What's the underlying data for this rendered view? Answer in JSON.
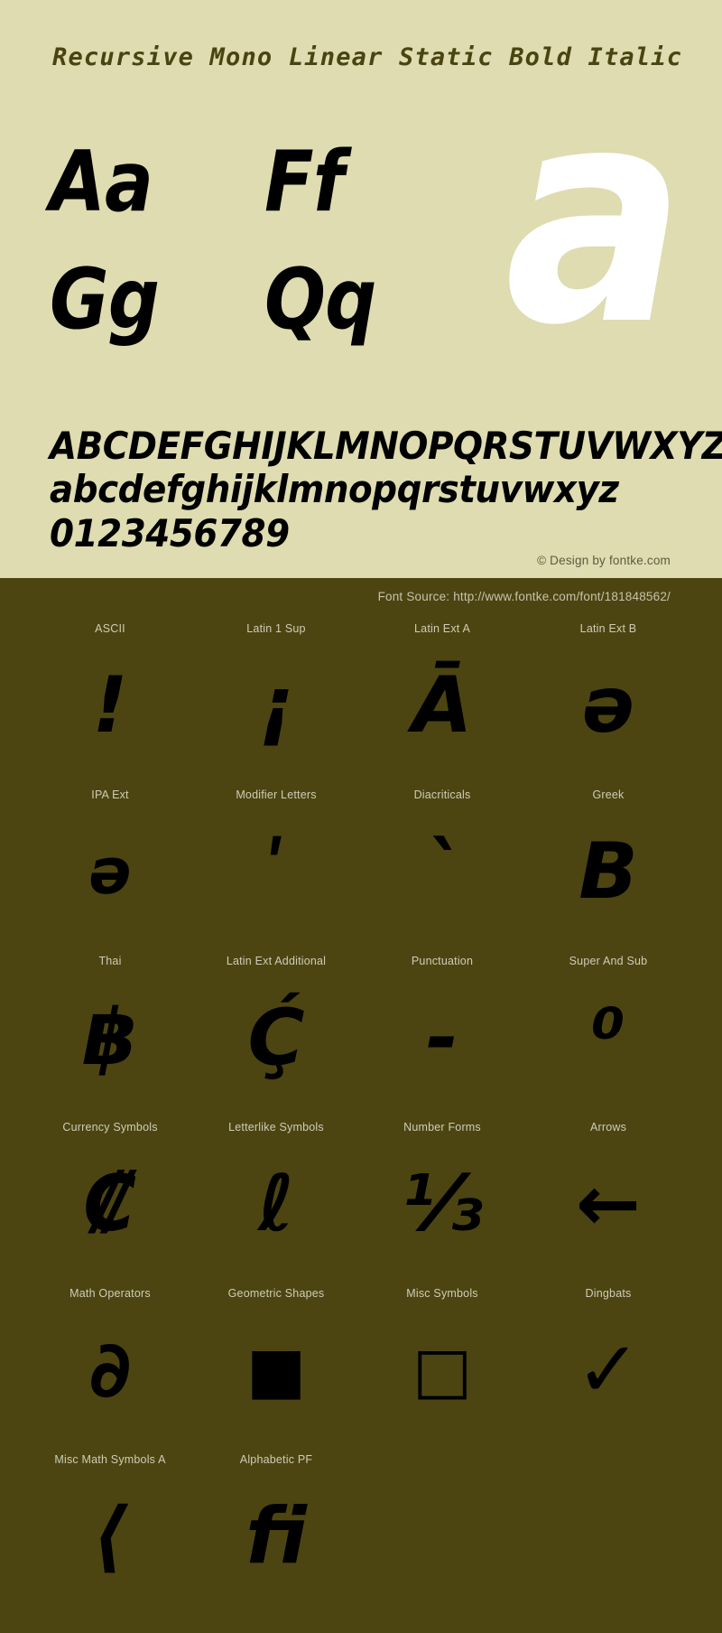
{
  "header": {
    "title": "Recursive Mono Linear Static Bold Italic",
    "background_color": "#dedcb0",
    "text_color": "#4a4312"
  },
  "specimen": {
    "letter_pairs": [
      "Aa",
      "Ff",
      "Gg",
      "Qq"
    ],
    "feature_glyph": "a",
    "feature_glyph_color": "#ffffff",
    "uppercase": "ABCDEFGHIJKLMNOPQRSTUVWXYZ",
    "lowercase": "abcdefghijklmnopqrstuvwxyz",
    "digits": "0123456789"
  },
  "credits": {
    "copyright": "© Design by fontke.com",
    "font_source": "Font Source: http://www.fontke.com/font/181848562/"
  },
  "glyph_grid": {
    "background_color": "#4c4512",
    "label_color": "#cfccb6",
    "glyph_color": "#000000",
    "rows": [
      [
        {
          "label": "ASCII",
          "glyph": "!",
          "size": "normal"
        },
        {
          "label": "Latin 1 Sup",
          "glyph": "¡",
          "size": "normal"
        },
        {
          "label": "Latin Ext A",
          "glyph": "Ā",
          "size": "normal"
        },
        {
          "label": "Latin Ext B",
          "glyph": "ə",
          "size": "normal"
        }
      ],
      [
        {
          "label": "IPA Ext",
          "glyph": "ə",
          "size": "small"
        },
        {
          "label": "Modifier Letters",
          "glyph": "ʹ",
          "size": "normal"
        },
        {
          "label": "Diacriticals",
          "glyph": "`",
          "size": "normal"
        },
        {
          "label": "Greek",
          "glyph": "Β",
          "size": "normal"
        }
      ],
      [
        {
          "label": "Thai",
          "glyph": "฿",
          "size": "normal"
        },
        {
          "label": "Latin Ext Additional",
          "glyph": "Ḉ",
          "size": "normal"
        },
        {
          "label": "Punctuation",
          "glyph": "‐",
          "size": "normal"
        },
        {
          "label": "Super And Sub",
          "glyph": "⁰",
          "size": "normal"
        }
      ],
      [
        {
          "label": "Currency Symbols",
          "glyph": "₡",
          "size": "normal"
        },
        {
          "label": "Letterlike Symbols",
          "glyph": "ℓ",
          "size": "normal"
        },
        {
          "label": "Number Forms",
          "glyph": "⅓",
          "size": "normal"
        },
        {
          "label": "Arrows",
          "glyph": "←",
          "size": "normal"
        }
      ],
      [
        {
          "label": "Math Operators",
          "glyph": "∂",
          "size": "normal"
        },
        {
          "label": "Geometric Shapes",
          "glyph": "■",
          "size": "small"
        },
        {
          "label": "Misc Symbols",
          "glyph": "□",
          "size": "small"
        },
        {
          "label": "Dingbats",
          "glyph": "✓",
          "size": "normal"
        }
      ],
      [
        {
          "label": "Misc Math Symbols A",
          "glyph": "⟨",
          "size": "normal"
        },
        {
          "label": "Alphabetic PF",
          "glyph": "ﬁ",
          "size": "normal"
        },
        {
          "label": "",
          "glyph": "",
          "size": "normal"
        },
        {
          "label": "",
          "glyph": "",
          "size": "normal"
        }
      ]
    ]
  }
}
